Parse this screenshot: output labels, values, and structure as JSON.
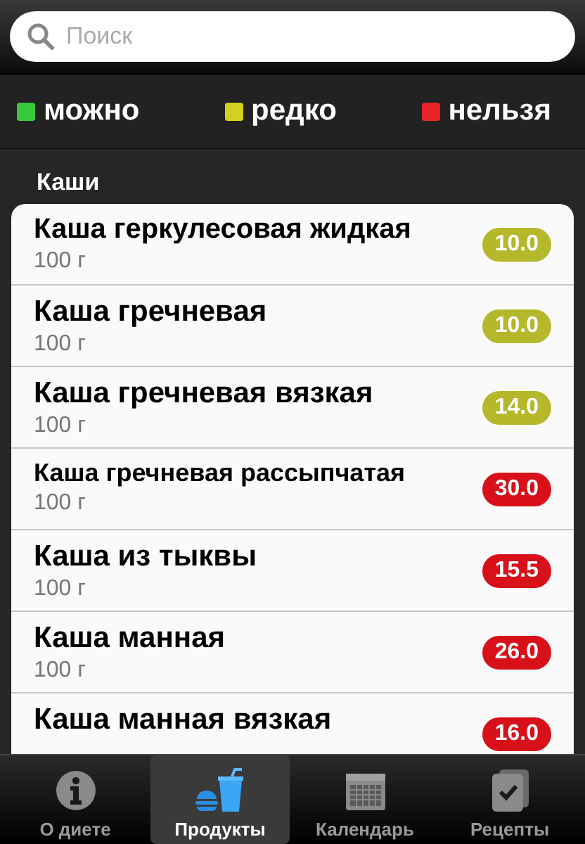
{
  "search": {
    "placeholder": "Поиск"
  },
  "legend": [
    {
      "label": "можно",
      "color": "#3cc83c"
    },
    {
      "label": "редко",
      "color": "#d4d020"
    },
    {
      "label": "нельзя",
      "color": "#e8242a"
    }
  ],
  "section": {
    "title": "Каши"
  },
  "items": [
    {
      "name": "Каша геркулесовая жидкая",
      "portion": "100 г",
      "value": "10.0",
      "color": "#b4b82a"
    },
    {
      "name": "Каша гречневая",
      "portion": "100 г",
      "value": "10.0",
      "color": "#b4b82a"
    },
    {
      "name": "Каша гречневая вязкая",
      "portion": "100 г",
      "value": "14.0",
      "color": "#b4b82a"
    },
    {
      "name": "Каша гречневая рассыпчатая",
      "portion": "100 г",
      "value": "30.0",
      "color": "#d8101a"
    },
    {
      "name": "Каша из тыквы",
      "portion": "100 г",
      "value": "15.5",
      "color": "#d8101a"
    },
    {
      "name": "Каша манная",
      "portion": "100 г",
      "value": "26.0",
      "color": "#d8101a"
    },
    {
      "name": "Каша манная вязкая",
      "value": "16.0",
      "color": "#d8101a"
    }
  ],
  "tabs": [
    {
      "label": "О диете",
      "kind": "info",
      "selected": false
    },
    {
      "label": "Продукты",
      "kind": "food",
      "selected": true
    },
    {
      "label": "Календарь",
      "kind": "calendar",
      "selected": false
    },
    {
      "label": "Рецепты",
      "kind": "recipes",
      "selected": false
    }
  ]
}
